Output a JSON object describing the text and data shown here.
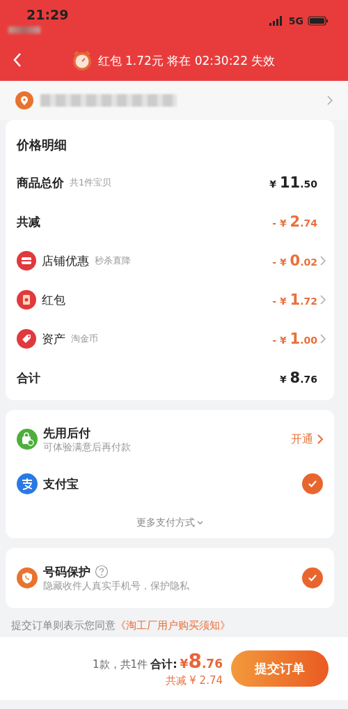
{
  "status_bar": {
    "time": "21:29",
    "network": "5G"
  },
  "header": {
    "notice": "红包 1.72元 将在 02:30:22 失效"
  },
  "price_detail": {
    "title": "价格明细",
    "rows": [
      {
        "kind": "plain",
        "label": "商品总价",
        "note": "共1件宝贝",
        "sign": "¥",
        "integer": "11",
        "decimal": ".50",
        "discount": false,
        "bold": true
      },
      {
        "kind": "plain",
        "label": "共减",
        "sign": "- ¥",
        "integer": "2",
        "decimal": ".74",
        "discount": true,
        "bold": true
      },
      {
        "kind": "icon",
        "label": "店铺优惠",
        "note": "秒杀直降",
        "sign": "- ¥",
        "integer": "0",
        "decimal": ".02",
        "discount": true,
        "bold": false
      },
      {
        "kind": "icon",
        "label": "红包",
        "sign": "- ¥",
        "integer": "1",
        "decimal": ".72",
        "discount": true,
        "bold": false
      },
      {
        "kind": "icon",
        "label": "资产",
        "note": "淘金币",
        "sign": "- ¥",
        "integer": "1",
        "decimal": ".00",
        "discount": true,
        "bold": false
      },
      {
        "kind": "plain",
        "label": "合计",
        "sign": "¥",
        "integer": "8",
        "decimal": ".76",
        "discount": false,
        "bold": true
      }
    ]
  },
  "payment": {
    "methods": [
      {
        "kind": "action",
        "name": "先用后付",
        "description": "可体验满意后再付款",
        "action": "开通"
      },
      {
        "kind": "choice",
        "name": "支付宝",
        "selected": true
      }
    ],
    "more": "更多支付方式"
  },
  "number_protection": {
    "title": "号码保护",
    "description": "隐藏收件人真实手机号，保护隐私",
    "checked": true
  },
  "agreement": {
    "text": "提交订单则表示您同意",
    "link": "《淘工厂用户购买须知》"
  },
  "footer": {
    "count": "1款，共1件",
    "total_label": "合计:",
    "sign": "¥",
    "integer": "8",
    "decimal": ".76",
    "discount": "共减 ¥ 2.74",
    "submit": "提交订单"
  }
}
